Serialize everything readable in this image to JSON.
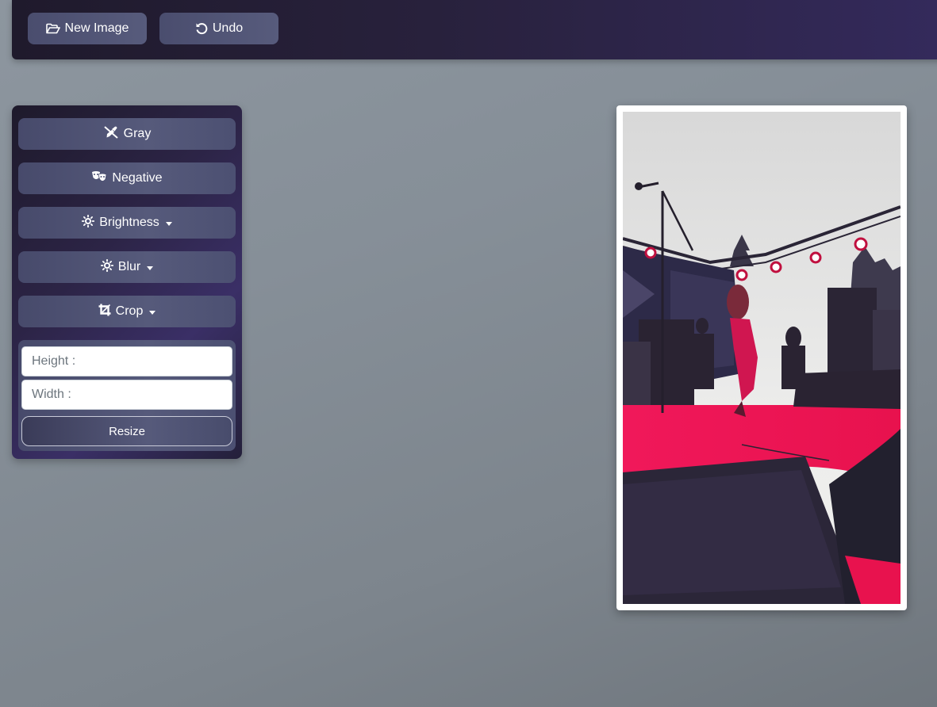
{
  "toolbar": {
    "new_image_label": "New Image",
    "new_image_icon": "folder-open-icon",
    "undo_label": "Undo",
    "undo_icon": "undo-icon"
  },
  "sidebar": {
    "gray_label": "Gray",
    "gray_icon": "eyedropper-slash-icon",
    "negative_label": "Negative",
    "negative_icon": "theater-masks-icon",
    "brightness_label": "Brightness",
    "brightness_icon": "sun-icon",
    "blur_label": "Blur",
    "blur_icon": "sun-icon",
    "crop_label": "Crop",
    "crop_icon": "crop-icon"
  },
  "resize": {
    "height_placeholder": "Height :",
    "width_placeholder": "Width :",
    "button_label": "Resize"
  },
  "colors": {
    "accent_magenta": "#e8124e",
    "toolbar_dark": "#1f1a2c",
    "toolbar_purple": "#342a5c",
    "button_slate": "#565a7b"
  }
}
